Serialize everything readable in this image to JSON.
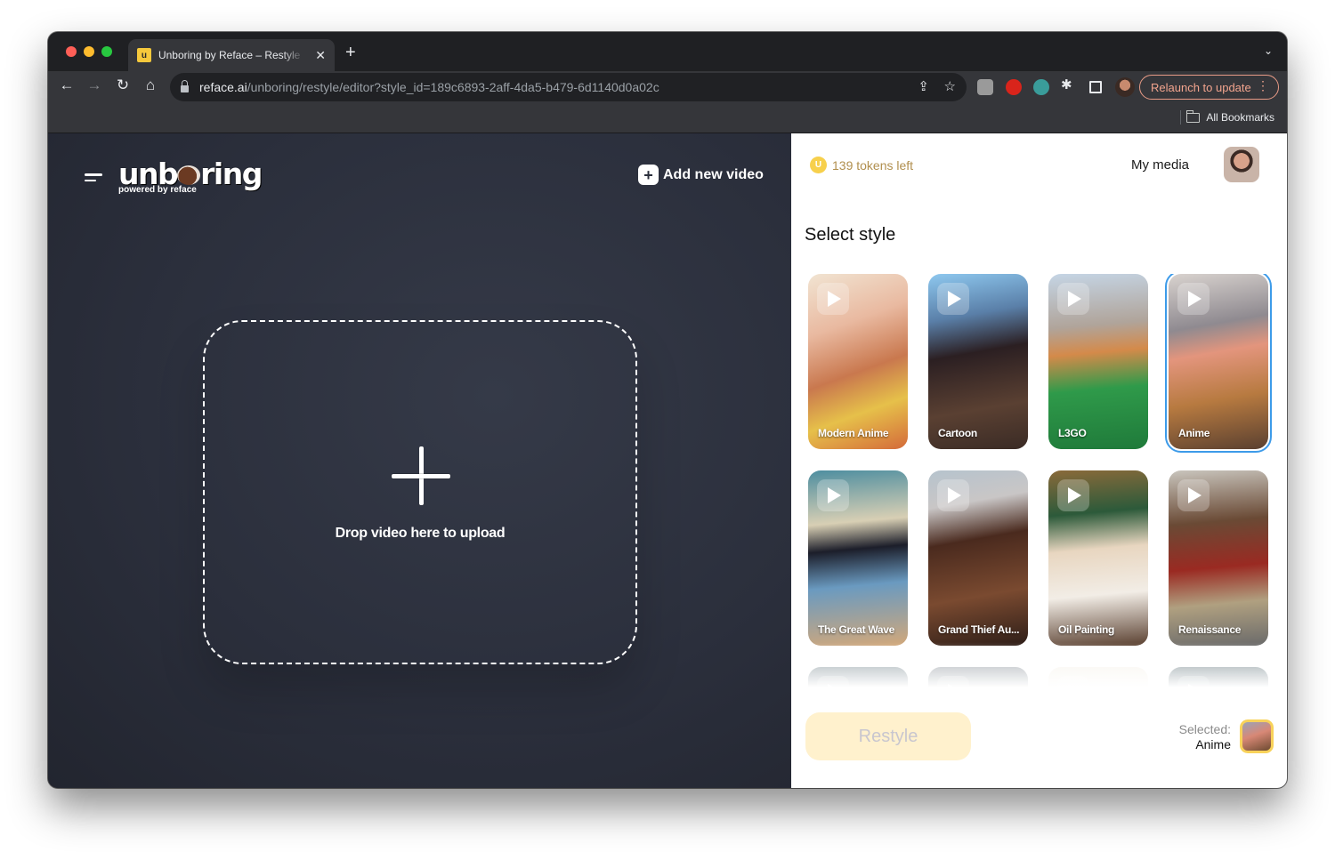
{
  "browser": {
    "tab": {
      "title": "Unboring by Reface – Restyle",
      "favicon": "u-favicon-icon"
    },
    "url": {
      "host": "reface.ai",
      "path": "/unboring/restyle/editor?style_id=189c6893-2aff-4da5-b479-6d1140d0a02c"
    },
    "relaunch_label": "Relaunch to update",
    "bookmarks_label": "All Bookmarks",
    "icons": {
      "back": "←",
      "forward": "→",
      "reload": "↻",
      "home": "⌂",
      "share": "⇪",
      "star": "☆",
      "new_tab": "+",
      "close": "✕",
      "tab_menu": "⌄",
      "extensions": "✱",
      "more": "⋮"
    }
  },
  "app": {
    "logo": {
      "word_a": "unb",
      "word_b": "ring",
      "subtitle": "powered by reface"
    },
    "add_video_label": "Add new video",
    "add_video_icon": "+",
    "dropzone": {
      "label": "Drop video here to upload"
    },
    "tokens": {
      "count_label": "139 tokens left",
      "coin_glyph": "U"
    },
    "my_media_label": "My media",
    "section_title": "Select style",
    "styles": [
      {
        "name": "Modern Anime",
        "selected": false,
        "bg": "linear-gradient(160deg,#f1e4d2 0%,#e9b9a0 30%,#c9784e 55%,#e6c04a 75%,#d46a3a 100%)"
      },
      {
        "name": "Cartoon",
        "selected": false,
        "bg": "linear-gradient(170deg,#8ec8ef 0%,#5a7fa8 25%,#2b1f22 45%,#5a4032 75%,#3a2b25 100%)"
      },
      {
        "name": "L3GO",
        "selected": false,
        "bg": "linear-gradient(175deg,#c5d5e5 0%,#b0a49a 30%,#d48a4a 45%,#2f9a4a 65%,#1f7a3a 100%)"
      },
      {
        "name": "Anime",
        "selected": true,
        "bg": "linear-gradient(170deg,#d9d3cf 0%,#8f8a90 30%,#e3957d 45%,#b77a40 70%,#5a4030 100%)"
      },
      {
        "name": "The Great Wave",
        "selected": false,
        "bg": "linear-gradient(175deg,#4e8ea0 0%,#d8cfb4 30%,#1c1e2a 45%,#6a9ac0 65%,#d2a87a 100%)"
      },
      {
        "name": "Grand Thief Au...",
        "selected": false,
        "bg": "linear-gradient(170deg,#b6c3cd 0%,#c9c6c6 20%,#4a2a1e 40%,#7a4a30 70%,#2e1e18 100%)"
      },
      {
        "name": "Oil Painting",
        "selected": false,
        "bg": "linear-gradient(175deg,#8a6a3a 0%,#2c5a3a 25%,#e8d6c0 45%,#f2ede6 70%,#5a4030 100%)"
      },
      {
        "name": "Renaissance",
        "selected": false,
        "bg": "linear-gradient(175deg,#c9c5bd 0%,#6a4a35 30%,#9a2a22 55%,#b0a080 75%,#6a6a6a 100%)"
      },
      {
        "name": "",
        "selected": false,
        "bg": "linear-gradient(180deg,#8a9aa0,#d8c0b0)"
      },
      {
        "name": "",
        "selected": false,
        "bg": "linear-gradient(180deg,#9aa0a6,#c0c0c0)"
      },
      {
        "name": "",
        "selected": false,
        "bg": "linear-gradient(180deg,#f6f2ea,#ffffff)"
      },
      {
        "name": "",
        "selected": false,
        "bg": "linear-gradient(180deg,#7a8a90,#b0b0b0)"
      }
    ],
    "restyle_label": "Restyle",
    "selected": {
      "key": "Selected:",
      "value": "Anime"
    }
  }
}
